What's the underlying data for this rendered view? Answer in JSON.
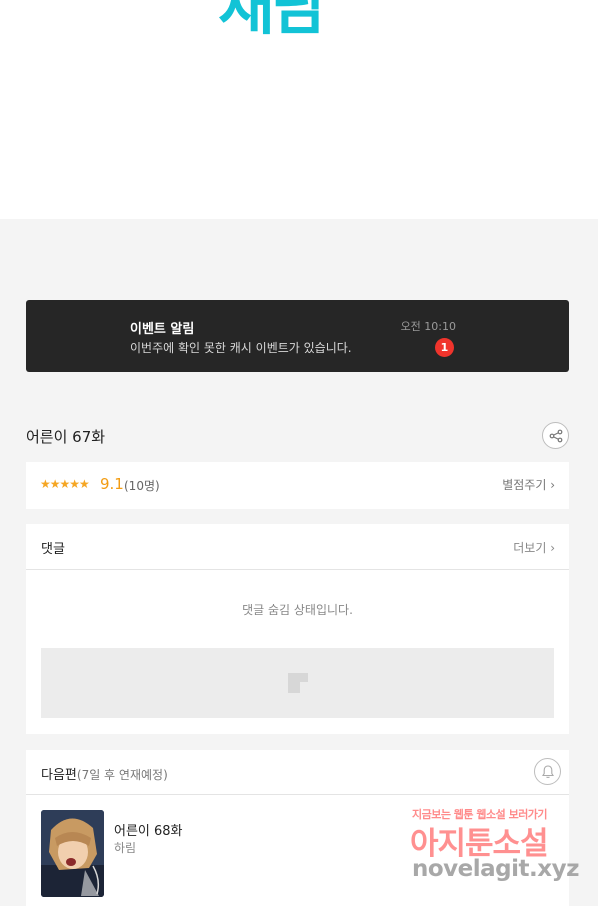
{
  "banner_logo": {
    "text": "재담"
  },
  "event": {
    "title": "이벤트 알림",
    "description": "이번주에 확인 못한 캐시 이벤트가 있습니다.",
    "time": "오전 10:10",
    "badge_count": "1"
  },
  "episode": {
    "title": "어른이 67화",
    "share_icon": "share-icon"
  },
  "rating": {
    "stars_text": "★★★★★",
    "stars_value": 4.5,
    "score": "9.1",
    "count": "(10명)",
    "rate_link": "별점주기 ›"
  },
  "comments": {
    "header": "댓글",
    "more_link": "더보기 ›",
    "hidden_message": "댓글 숨김 상태입니다."
  },
  "next_episode": {
    "header": "다음편",
    "header_note": "(7일 후 연재예정)",
    "title": "어른이 68화",
    "author": "하림",
    "bell_icon": "bell-icon"
  },
  "watermark": {
    "line1": "지금보는 웹툰 웹소설 보러가기",
    "line2": "아지툰소설",
    "line3": "novelagit.xyz"
  },
  "colors": {
    "brand_cyan": "#12c3d6",
    "badge_red": "#f0342c",
    "star_orange": "#f5a623",
    "banner_dark": "#262626"
  }
}
